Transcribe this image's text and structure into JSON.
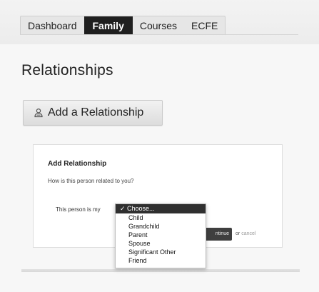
{
  "tabs": [
    {
      "label": "Dashboard",
      "active": false
    },
    {
      "label": "Family",
      "active": true
    },
    {
      "label": "Courses",
      "active": false
    },
    {
      "label": "ECFE",
      "active": false
    }
  ],
  "page_title": "Relationships",
  "add_button": {
    "label": "Add a Relationship",
    "icon": "person-icon"
  },
  "card": {
    "title": "Add Relationship",
    "question": "How is this person related to you?",
    "row_label": "This person is my",
    "continue_label": "ntinue",
    "or_text": "or",
    "cancel_label": "cancel"
  },
  "dropdown": {
    "selected_check": "✓",
    "options": [
      "Choose...",
      "Child",
      "Grandchild",
      "Parent",
      "Spouse",
      "Significant Other",
      "Friend"
    ]
  },
  "colors": {
    "active_tab_bg": "#1f1f1f",
    "selected_option_bg": "#2f2f2f",
    "continue_button_bg": "#3f3f3f"
  }
}
